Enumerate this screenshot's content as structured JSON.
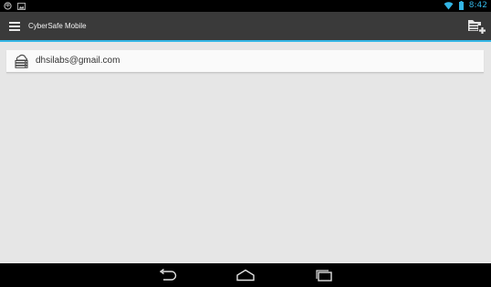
{
  "status_bar": {
    "time": "8:42",
    "left_icons": [
      "sync-icon",
      "image-icon"
    ],
    "right_icons": [
      "wifi-icon",
      "battery-icon"
    ],
    "accent_color": "#33b5e5"
  },
  "action_bar": {
    "menu_icon": "hamburger-icon",
    "title": "CyberSafe Mobile",
    "action_icon": "add-folder-icon",
    "background": "#3a3a3a",
    "underline_color": "#33b5e5"
  },
  "accounts": [
    {
      "label": "dhsilabs@gmail.com",
      "icon": "cloud-drive-icon"
    }
  ],
  "nav_bar": {
    "buttons": [
      "back-icon",
      "home-icon",
      "recents-icon"
    ]
  }
}
